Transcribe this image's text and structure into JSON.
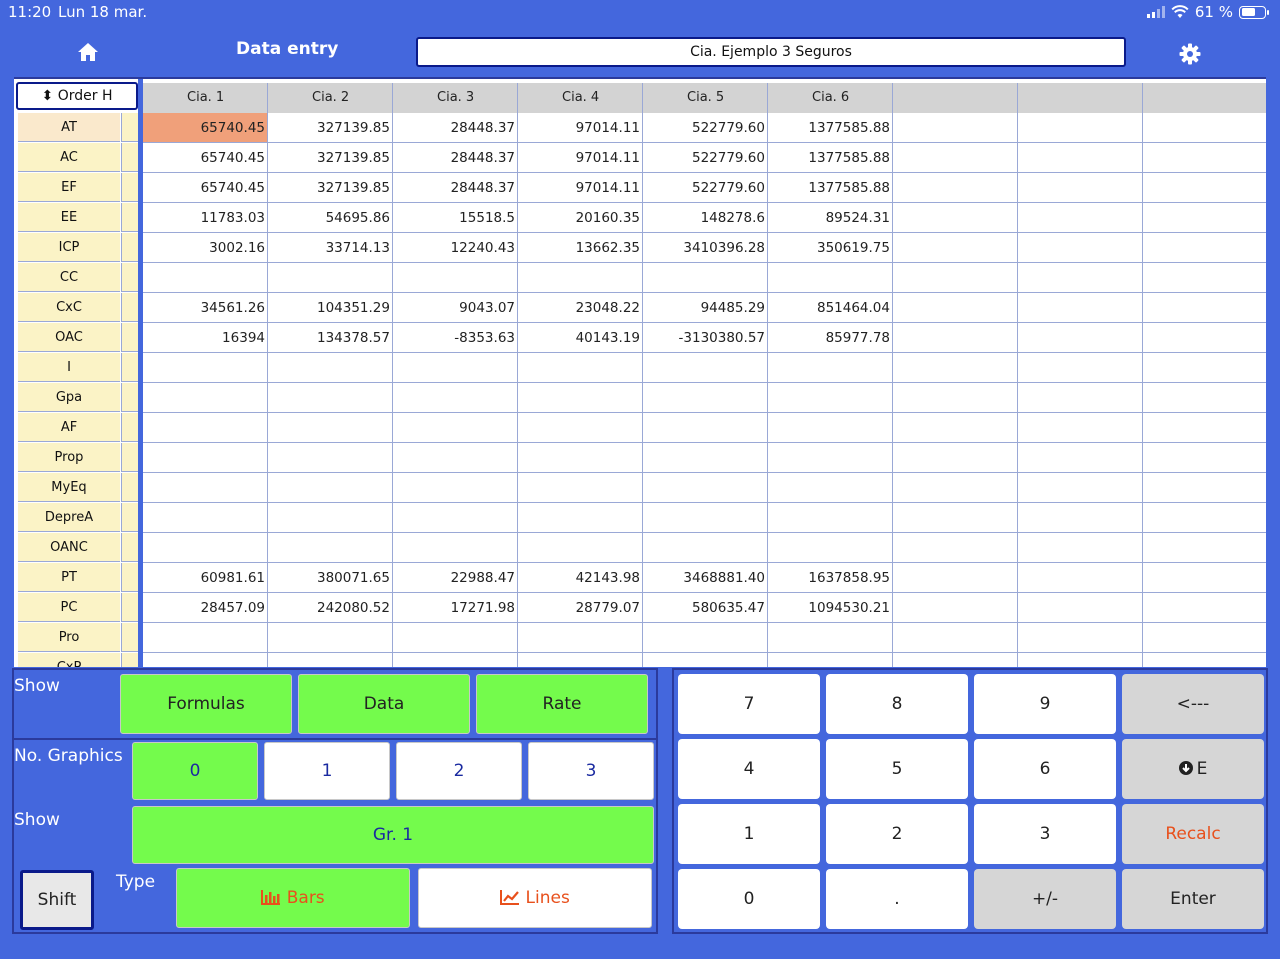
{
  "status": {
    "time": "11:20",
    "date": "Lun 18 mar.",
    "battery": "61 %",
    "battery_level": 0.61
  },
  "header": {
    "title": "Data entry",
    "company": "Cia. Ejemplo 3 Seguros"
  },
  "grid": {
    "order_button": "Order H",
    "columns": [
      "Cia. 1",
      "Cia. 2",
      "Cia. 3",
      "Cia. 4",
      "Cia. 5",
      "Cia. 6",
      "",
      "",
      ""
    ],
    "selected_cell": [
      0,
      0
    ],
    "rows": [
      {
        "label": "AT",
        "values": [
          "65740.45",
          "327139.85",
          "28448.37",
          "97014.11",
          "522779.60",
          "1377585.88"
        ]
      },
      {
        "label": "AC",
        "values": [
          "65740.45",
          "327139.85",
          "28448.37",
          "97014.11",
          "522779.60",
          "1377585.88"
        ]
      },
      {
        "label": "EF",
        "values": [
          "65740.45",
          "327139.85",
          "28448.37",
          "97014.11",
          "522779.60",
          "1377585.88"
        ]
      },
      {
        "label": "EE",
        "values": [
          "11783.03",
          "54695.86",
          "15518.5",
          "20160.35",
          "148278.6",
          "89524.31"
        ]
      },
      {
        "label": "ICP",
        "values": [
          "3002.16",
          "33714.13",
          "12240.43",
          "13662.35",
          "3410396.28",
          "350619.75"
        ]
      },
      {
        "label": "CC",
        "values": [
          "",
          "",
          "",
          "",
          "",
          ""
        ]
      },
      {
        "label": "CxC",
        "values": [
          "34561.26",
          "104351.29",
          "9043.07",
          "23048.22",
          "94485.29",
          "851464.04"
        ]
      },
      {
        "label": "OAC",
        "values": [
          "16394",
          "134378.57",
          "-8353.63",
          "40143.19",
          "-3130380.57",
          "85977.78"
        ]
      },
      {
        "label": "I",
        "values": [
          "",
          "",
          "",
          "",
          "",
          ""
        ]
      },
      {
        "label": "Gpa",
        "values": [
          "",
          "",
          "",
          "",
          "",
          ""
        ]
      },
      {
        "label": "AF",
        "values": [
          "",
          "",
          "",
          "",
          "",
          ""
        ]
      },
      {
        "label": "Prop",
        "values": [
          "",
          "",
          "",
          "",
          "",
          ""
        ]
      },
      {
        "label": "MyEq",
        "values": [
          "",
          "",
          "",
          "",
          "",
          ""
        ]
      },
      {
        "label": "DepreA",
        "values": [
          "",
          "",
          "",
          "",
          "",
          ""
        ]
      },
      {
        "label": "OANC",
        "values": [
          "",
          "",
          "",
          "",
          "",
          ""
        ]
      },
      {
        "label": "PT",
        "values": [
          "60981.61",
          "380071.65",
          "22988.47",
          "42143.98",
          "3468881.40",
          "1637858.95"
        ]
      },
      {
        "label": "PC",
        "values": [
          "28457.09",
          "242080.52",
          "17271.98",
          "28779.07",
          "580635.47",
          "1094530.21"
        ]
      },
      {
        "label": "Pro",
        "values": [
          "",
          "",
          "",
          "",
          "",
          ""
        ]
      },
      {
        "label": "CxP",
        "values": [
          "",
          "",
          "",
          "",
          "",
          ""
        ]
      }
    ]
  },
  "controls": {
    "show_label": "Show",
    "show_buttons": [
      "Formulas",
      "Data",
      "Rate"
    ],
    "no_graphics_label": "No. Graphics",
    "graphics_buttons": [
      "0",
      "1",
      "2",
      "3"
    ],
    "show2_label": "Show",
    "graph_button": "Gr. 1",
    "shift": "Shift",
    "type_label": "Type",
    "bars": "Bars",
    "lines": "Lines"
  },
  "keypad": {
    "keys": [
      "7",
      "8",
      "9",
      "<---",
      "4",
      "5",
      "6",
      "E",
      "1",
      "2",
      "3",
      "Recalc",
      "0",
      ".",
      "+/-",
      "Enter"
    ]
  },
  "colors": {
    "background": "#4467dd",
    "green": "#74fb4c",
    "selected": "#f0a07a",
    "accent_red": "#e8501c"
  }
}
